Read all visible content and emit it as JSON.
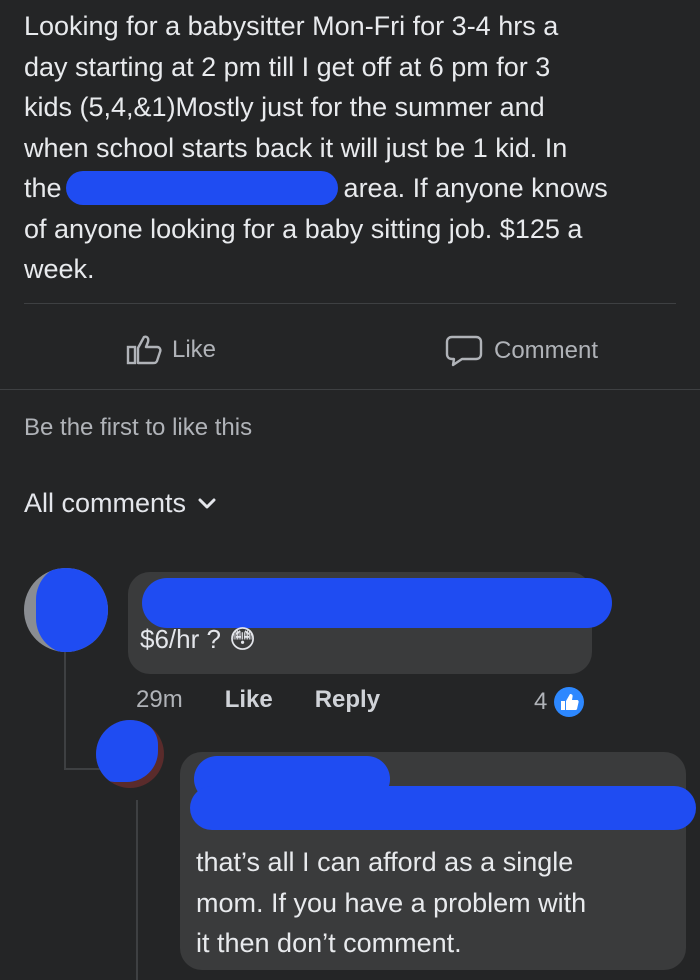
{
  "post": {
    "line1": "Looking for a babysitter Mon-Fri for 3-4 hrs a",
    "line2": "day starting at 2 pm till I get off at 6 pm for 3",
    "line3": "kids (5,4,&1)Mostly just for the summer and",
    "line4": "when school starts back it will just be 1 kid. In",
    "line5_start": "the",
    "line5_end": "area. If anyone knows",
    "line6": "of anyone looking for a baby sitting job. $125 a",
    "line7": "week."
  },
  "actions": {
    "like_label": "Like",
    "comment_label": "Comment"
  },
  "reactions": {
    "summary": "Be the first to like this"
  },
  "comments_header": {
    "label": "All comments"
  },
  "comment1": {
    "text": "$6/hr ?",
    "emoji": "😳",
    "time": "29m",
    "like_label": "Like",
    "reply_label": "Reply",
    "reaction_count": "4"
  },
  "reply1": {
    "line1": "that’s all I can afford as a single",
    "line2": "mom. If you have a problem with",
    "line3": "it then don’t comment."
  },
  "colors": {
    "background": "#242526",
    "bubble": "#3a3b3c",
    "redaction": "#1f4cf2",
    "like_blue": "#2d88ff"
  }
}
